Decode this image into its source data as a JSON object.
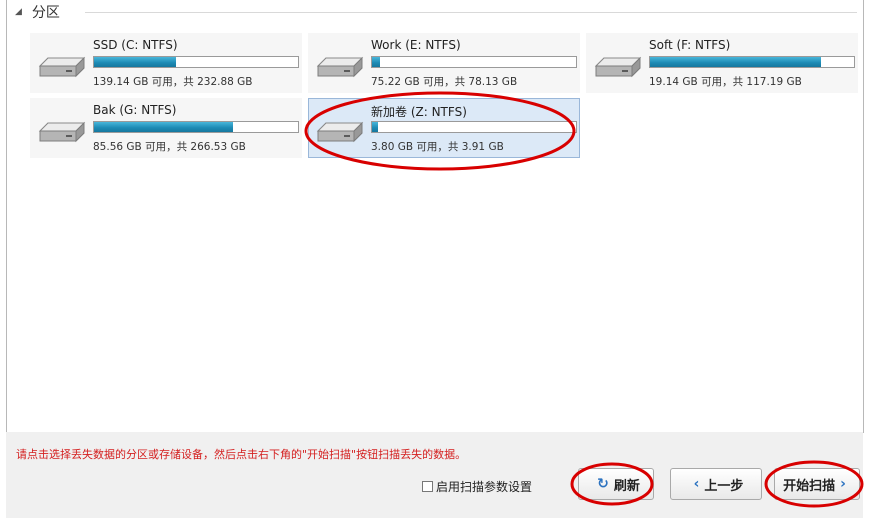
{
  "section": {
    "title": "分区"
  },
  "partitions": [
    {
      "label": "SSD (C: NTFS)",
      "info": "139.14 GB 可用，共 232.88 GB",
      "used_fraction": 0.4
    },
    {
      "label": "Work (E: NTFS)",
      "info": "75.22 GB 可用，共 78.13 GB",
      "used_fraction": 0.04
    },
    {
      "label": "Soft (F: NTFS)",
      "info": "19.14 GB 可用，共 117.19 GB",
      "used_fraction": 0.84
    },
    {
      "label": "Bak (G: NTFS)",
      "info": "85.56 GB 可用，共 266.53 GB",
      "used_fraction": 0.68
    },
    {
      "label": "新加卷 (Z: NTFS)",
      "info": "3.80 GB 可用，共 3.91 GB",
      "used_fraction": 0.03,
      "selected": true
    }
  ],
  "footer": {
    "hint": "请点击选择丢失数据的分区或存储设备，然后点击右下角的\"开始扫描\"按钮扫描丢失的数据。",
    "checkbox_label": "启用扫描参数设置",
    "refresh_label": "刷新",
    "back_label": "上一步",
    "start_label": "开始扫描"
  },
  "icons": {
    "refresh": "refresh-icon",
    "back": "chevron-left-icon",
    "next": "chevron-right-icon",
    "drive": "hard-drive-icon"
  },
  "colors": {
    "hint_text": "#d42020",
    "usage_bar": "#1e8cb6",
    "selected_tile": "#dce9f7",
    "annotation": "#d80000",
    "button_icon": "#2b72c0"
  }
}
